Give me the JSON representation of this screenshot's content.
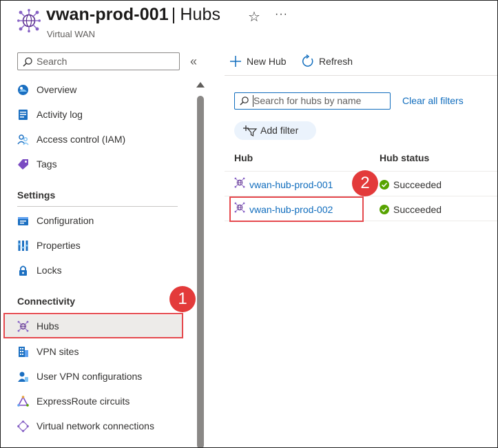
{
  "header": {
    "resource_name": "vwan-prod-001",
    "separator": "|",
    "page_name": "Hubs",
    "subtitle": "Virtual WAN",
    "favorite_glyph": "☆",
    "more_glyph": "···",
    "icon": "virtual-wan-icon"
  },
  "sidebar": {
    "search_placeholder": "Search",
    "collapse_glyph": "«",
    "top_items": [
      {
        "label": "Overview",
        "icon": "overview-icon"
      },
      {
        "label": "Activity log",
        "icon": "activity-log-icon"
      },
      {
        "label": "Access control (IAM)",
        "icon": "iam-icon"
      },
      {
        "label": "Tags",
        "icon": "tag-icon"
      }
    ],
    "sections": [
      {
        "title": "Settings",
        "items": [
          {
            "label": "Configuration",
            "icon": "configuration-icon"
          },
          {
            "label": "Properties",
            "icon": "properties-icon"
          },
          {
            "label": "Locks",
            "icon": "lock-icon"
          }
        ]
      },
      {
        "title": "Connectivity",
        "items": [
          {
            "label": "Hubs",
            "icon": "hub-icon",
            "selected": true
          },
          {
            "label": "VPN sites",
            "icon": "vpn-site-icon"
          },
          {
            "label": "User VPN configurations",
            "icon": "user-vpn-icon"
          },
          {
            "label": "ExpressRoute circuits",
            "icon": "expressroute-icon"
          },
          {
            "label": "Virtual network connections",
            "icon": "vnet-connection-icon"
          }
        ]
      }
    ]
  },
  "toolbar": {
    "new_hub": "New Hub",
    "refresh": "Refresh"
  },
  "filters": {
    "search_placeholder": "Search for hubs by name",
    "clear_all": "Clear all filters",
    "add_filter": "Add filter"
  },
  "table": {
    "columns": [
      "Hub",
      "Hub status"
    ],
    "rows": [
      {
        "hub": "vwan-hub-prod-001",
        "status": "Succeeded"
      },
      {
        "hub": "vwan-hub-prod-002",
        "status": "Succeeded"
      }
    ]
  },
  "callouts": [
    "1",
    "2"
  ],
  "colors": {
    "accent": "#0f6cbd",
    "callout": "#e33a3a",
    "success": "#57a300",
    "selected_bg": "#edebe9"
  }
}
